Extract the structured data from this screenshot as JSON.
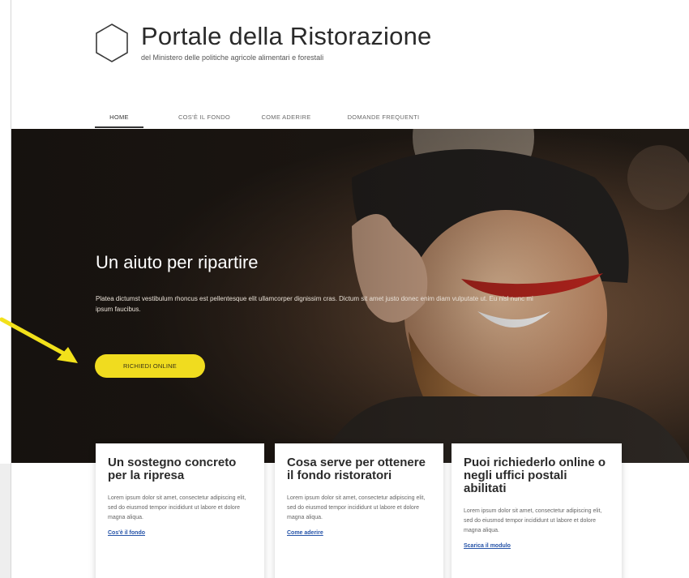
{
  "header": {
    "title": "Portale della Ristorazione",
    "subtitle": "del Ministero delle politiche agricole alimentari e forestali"
  },
  "nav": {
    "items": [
      {
        "label": "HOME",
        "active": true
      },
      {
        "label": "COS'È IL FONDO",
        "active": false
      },
      {
        "label": "COME ADERIRE",
        "active": false
      },
      {
        "label": "DOMANDE FREQUENTI",
        "active": false
      }
    ]
  },
  "hero": {
    "title": "Un aiuto per ripartire",
    "text": "Platea dictumst vestibulum rhoncus est pellentesque elit ullamcorper dignissim cras. Dictum sit amet justo donec enim diam vulputate ut. Eu nisl nunc mi ipsum faucibus.",
    "button_label": "RICHIEDI ONLINE"
  },
  "cards": [
    {
      "title": "Un sostegno concreto per la ripresa",
      "text": "Lorem ipsum dolor sit amet, consectetur adipiscing elit, sed do eiusmod tempor incididunt ut labore et dolore magna aliqua.",
      "link": "Cos'è il fondo"
    },
    {
      "title": "Cosa serve per ottenere il fondo ristoratori",
      "text": "Lorem ipsum dolor sit amet, consectetur adipiscing elit, sed do eiusmod tempor incididunt ut labore et dolore magna aliqua.",
      "link": "Come aderire"
    },
    {
      "title": "Puoi richiederlo online o negli uffici postali abilitati",
      "text": "Lorem ipsum dolor sit amet, consectetur adipiscing elit, sed do eiusmod tempor incididunt ut labore et dolore magna aliqua.",
      "link": "Scarica il modulo"
    }
  ],
  "colors": {
    "button": "#f0dc1f",
    "arrow": "#f2e11b",
    "link": "#2553a8"
  },
  "icons": {
    "logo": "hexagon-outline-icon",
    "annotation": "arrow-icon"
  }
}
